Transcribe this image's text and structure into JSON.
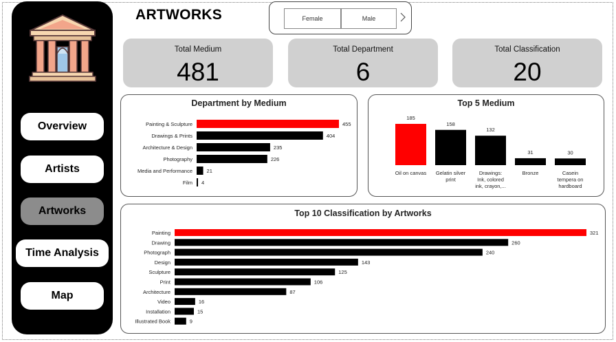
{
  "header": {
    "title": "ARTWORKS"
  },
  "slicer": {
    "options": [
      "Female",
      "Male"
    ],
    "next_icon": "chevron-right-icon"
  },
  "nav": {
    "items": [
      {
        "label": "Overview",
        "active": false
      },
      {
        "label": "Artists",
        "active": false
      },
      {
        "label": "Artworks",
        "active": true
      },
      {
        "label": "Time Analysis",
        "active": false
      },
      {
        "label": "Map",
        "active": false
      }
    ],
    "logo_icon": "museum-building-icon"
  },
  "kpis": [
    {
      "label": "Total Medium",
      "value": "481"
    },
    {
      "label": "Total Department",
      "value": "6"
    },
    {
      "label": "Total Classification",
      "value": "20"
    }
  ],
  "colors": {
    "highlight": "#ff0000",
    "bar": "#000000",
    "card": "#d0d0d0",
    "sidebar": "#000000",
    "active_nav": "#8c8c8c"
  },
  "chart_data": [
    {
      "type": "bar",
      "orientation": "horizontal",
      "title": "Department by Medium",
      "categories": [
        "Painting & Sculpture",
        "Drawings & Prints",
        "Architecture & Design",
        "Photography",
        "Media and Performance",
        "Film"
      ],
      "values": [
        455,
        404,
        235,
        226,
        21,
        4
      ],
      "highlight_index": 0,
      "data_labels": true
    },
    {
      "type": "bar",
      "orientation": "vertical",
      "title": "Top 5 Medium",
      "categories": [
        [
          "Oil on canvas"
        ],
        [
          "Gelatin silver",
          "print"
        ],
        [
          "Drawings:",
          "Ink, colored",
          "ink, crayon,..."
        ],
        [
          "Bronze"
        ],
        [
          "Casein",
          "tempera on",
          "hardboard"
        ]
      ],
      "values": [
        185,
        158,
        132,
        31,
        30
      ],
      "highlight_index": 0,
      "data_labels": true
    },
    {
      "type": "bar",
      "orientation": "horizontal",
      "title": "Top 10 Classification by Artworks",
      "categories": [
        "Painting",
        "Drawing",
        "Photograph",
        "Design",
        "Sculpture",
        "Print",
        "Architecture",
        "Video",
        "Installation",
        "Illustrated Book"
      ],
      "values": [
        321,
        260,
        240,
        143,
        125,
        106,
        87,
        16,
        15,
        9
      ],
      "highlight_index": 0,
      "data_labels": true
    }
  ]
}
